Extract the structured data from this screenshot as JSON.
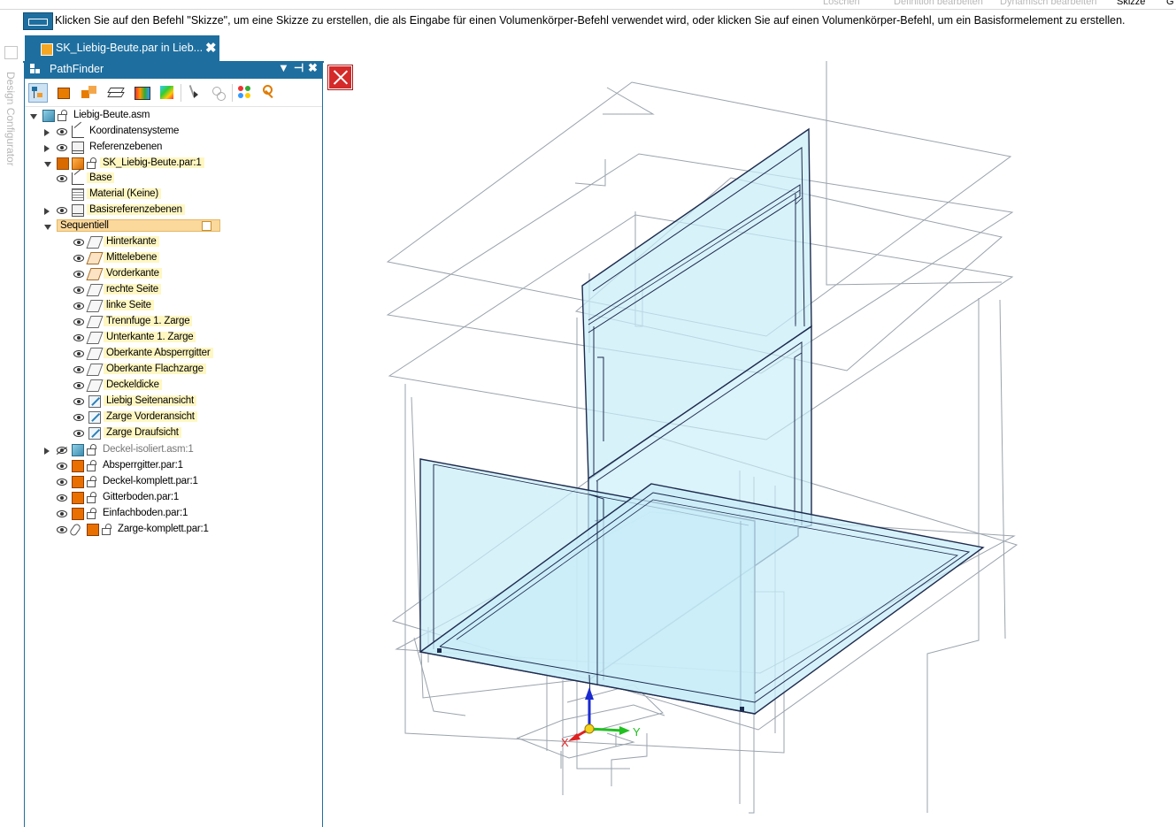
{
  "toolbar_top": {
    "items": [
      "Löschen",
      "Definition bearbeiten",
      "Dynamisch bearbeiten",
      "Skizze"
    ],
    "partial_item": "G"
  },
  "prompt": {
    "text": "Klicken Sie auf den Befehl \"Skizze\", um eine Skizze zu erstellen, die als Eingabe für einen Volumenkörper-Befehl verwendet wird, oder klicken Sie auf einen Volumenkörper-Befehl, um ein Basisformelement zu erstellen."
  },
  "side_strip": {
    "label": "Design Configurator"
  },
  "document_tab": {
    "label": "SK_Liebig-Beute.par in Lieb...",
    "close": "✖"
  },
  "pathfinder": {
    "title": "PathFinder",
    "header_buttons": [
      "▼",
      "⊣",
      "✖"
    ],
    "tree": [
      {
        "label": "Liebig-Beute.asm"
      },
      {
        "label": "Koordinatensysteme"
      },
      {
        "label": "Referenzebenen"
      },
      {
        "label": "SK_Liebig-Beute.par:1"
      },
      {
        "label": "Base"
      },
      {
        "label": "Material (Keine)"
      },
      {
        "label": "Basisreferenzebenen"
      },
      {
        "label": "Sequentiell"
      },
      {
        "label": "Hinterkante"
      },
      {
        "label": "Mittelebene"
      },
      {
        "label": "Vorderkante"
      },
      {
        "label": "rechte Seite"
      },
      {
        "label": "linke Seite"
      },
      {
        "label": "Trennfuge 1. Zarge"
      },
      {
        "label": "Unterkante 1. Zarge"
      },
      {
        "label": "Oberkante Absperrgitter"
      },
      {
        "label": "Oberkante Flachzarge"
      },
      {
        "label": "Deckeldicke"
      },
      {
        "label": "Liebig Seitenansicht"
      },
      {
        "label": "Zarge Vorderansicht"
      },
      {
        "label": "Zarge Draufsicht"
      },
      {
        "label": "Deckel-isoliert.asm:1"
      },
      {
        "label": "Absperrgitter.par:1"
      },
      {
        "label": "Deckel-komplett.par:1"
      },
      {
        "label": "Gitterboden.par:1"
      },
      {
        "label": "Einfachboden.par:1"
      },
      {
        "label": "Zarge-komplett.par:1"
      }
    ]
  },
  "viewport": {
    "triad": {
      "x_label": "X",
      "y_label": "Y"
    },
    "colors": {
      "x": "#e02020",
      "y": "#20c020",
      "z": "#1a2ad0",
      "edges": "#1d2b4e",
      "face": "#c8ecf8"
    }
  }
}
